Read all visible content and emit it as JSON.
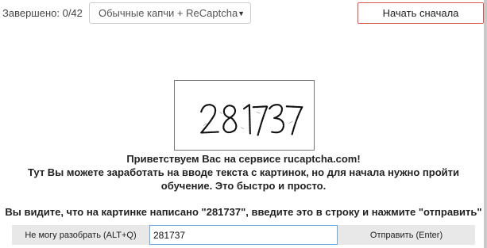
{
  "header": {
    "progress_text": "Завершено: 0/42",
    "mode_select_value": "Обычные капчи + ReCaptcha",
    "restart_label": "Начать сначала",
    "accent_color": "#d9534f"
  },
  "captcha": {
    "image_text": "281737"
  },
  "intro": {
    "line1": "Приветствуем Вас на сервисе rucaptcha.com!",
    "line2": "Тут Вы можете заработать на вводе текста с картинок, но для начала нужно пройти",
    "line3": "обучение. Это быстро и просто."
  },
  "instruction": "Вы видите, что на картинке написано \"281737\", введите это в строку и нажмите \"отправить\"",
  "controls": {
    "cant_solve_label": "Не могу разобрать (ALT+Q)",
    "answer_value": "281737",
    "send_label": "Отправить (Enter)"
  }
}
